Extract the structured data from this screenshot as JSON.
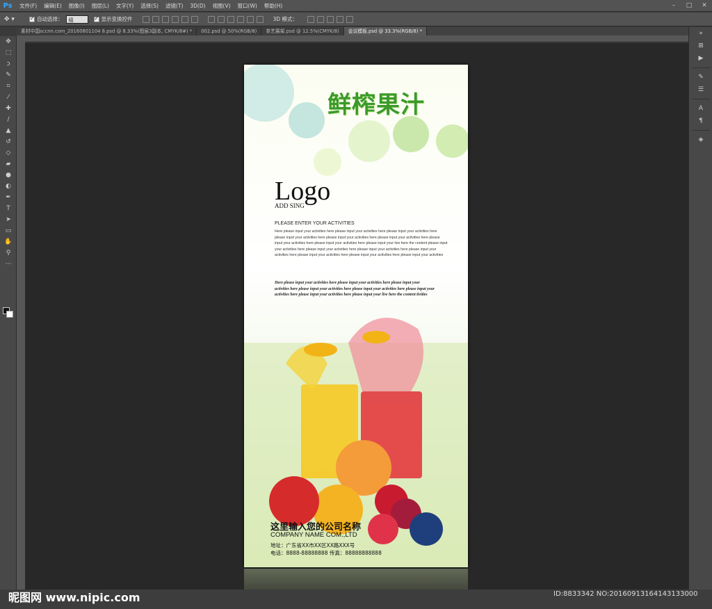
{
  "app": {
    "logo": "Ps"
  },
  "menu": [
    "文件(F)",
    "编辑(E)",
    "图像(I)",
    "图层(L)",
    "文字(Y)",
    "选择(S)",
    "滤镜(T)",
    "3D(D)",
    "视图(V)",
    "窗口(W)",
    "帮助(H)"
  ],
  "options": {
    "auto_select_label": "自动选择：",
    "auto_select_value": "组",
    "show_transform_label": "显示变换控件",
    "mode_3d_label": "3D 模式："
  },
  "tabs": [
    {
      "label": "素材中国sccnn.com_20160801104 8.psd @ 8.33%(图层3副本, CMYK/8#) *",
      "active": false
    },
    {
      "label": "002.psd @ 50%(RGB/8)",
      "active": false
    },
    {
      "label": "茶艺展架.psd @ 12.5%(CMYK/8)",
      "active": false
    },
    {
      "label": "会议模板.psd @ 33.3%(RGB/8) *",
      "active": true
    }
  ],
  "poster": {
    "title": "鲜榨果汁",
    "logo": "Logo",
    "add_sing": "ADD SING",
    "subhead": "PLEASE ENTER YOUR ACTIVITIES",
    "body": "Here please input your activities here please input your activities here please input your activities here please input your activities here please input your activities here please input your activities here please input your activities here please input your activities here please input your live here the content please input your activities here please input your activities here please input your activities here please input your activities here please input your activities here please input your activities here please input your activities",
    "italic": "Here please input your activities here please input your activities here please input your activities here please input your activities here please input your activities here please input your activities here please input your activities here please input your live here the content tivities",
    "company_cn": "这里输入您的公司名称",
    "company_en": "COMPANY NAME COM.,LTD",
    "address": "地址：广东省XX市XX区XX路XXX号",
    "phone": "电话：8888-88888888  传真：88888888888"
  },
  "watermark": {
    "left": "昵图网 www.nipic.com",
    "right": "ID:8833342 NO:20160913164143133000"
  },
  "colors": {
    "accent": "#31a8ff",
    "title_green": "#3a9a2a"
  }
}
